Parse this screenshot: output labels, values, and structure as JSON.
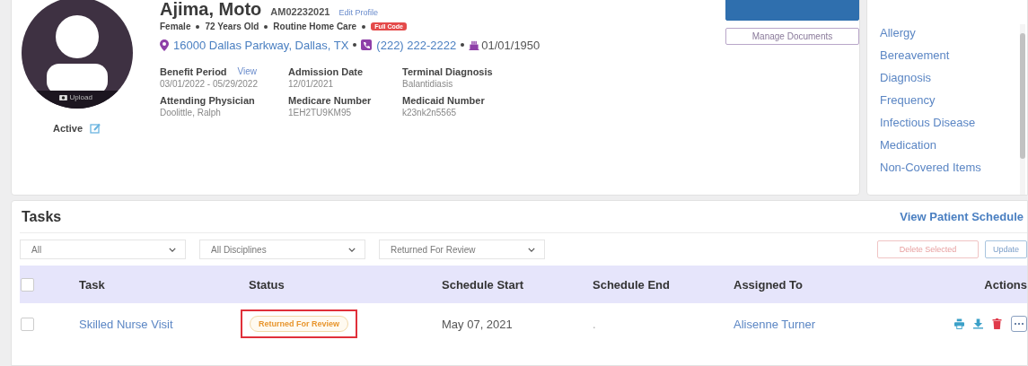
{
  "patient": {
    "name": "Ajima, Moto",
    "mrn": "AM02232021",
    "edit_link": "Edit Profile",
    "upload_label": "Upload",
    "status": "Active",
    "summary": [
      "Female",
      "72 Years Old",
      "Routine Home Care"
    ],
    "badge": "Full Code",
    "address": "16000 Dallas Parkway, Dallas, TX",
    "phone": "(222) 222-2222",
    "birth_date": "01/01/1950",
    "fields": [
      {
        "label": "Benefit Period",
        "link": "View",
        "value": "03/01/2022 - 05/29/2022"
      },
      {
        "label": "Admission Date",
        "value": "12/01/2021"
      },
      {
        "label": "Terminal Diagnosis",
        "value": "Balantidiasis"
      },
      {
        "label": "Attending Physician",
        "value": "Doolittle, Ralph"
      },
      {
        "label": "Medicare Number",
        "value": "1EH2TU9KM95"
      },
      {
        "label": "Medicaid Number",
        "value": "k23nk2n5565"
      }
    ],
    "buttons": [
      {
        "kind": "primary"
      },
      {
        "kind": "outline",
        "label": "Manage Documents"
      }
    ]
  },
  "quick_links": {
    "items": [
      "Allergy",
      "Bereavement",
      "Diagnosis",
      "Frequency",
      "Infectious Disease",
      "Medication",
      "Non-Covered Items"
    ]
  },
  "tasks": {
    "title": "Tasks",
    "schedule_link": "View Patient Schedule",
    "filters": [
      "All",
      "All Disciplines",
      "Returned For Review"
    ],
    "buttons": [
      {
        "kind": "danger",
        "label": "Delete Selected"
      },
      {
        "kind": "outline",
        "label": "Update"
      }
    ],
    "select_all_checked": false,
    "columns": [
      "Task",
      "Status",
      "Schedule Start",
      "Schedule End",
      "Assigned To",
      "Actions"
    ],
    "rows": [
      {
        "checked": false,
        "task": "Skilled Nurse Visit",
        "status": "Returned For Review",
        "highlighted": true,
        "start": "May 07, 2021",
        "end": ".",
        "assigned": "Alisenne Turner"
      }
    ]
  }
}
